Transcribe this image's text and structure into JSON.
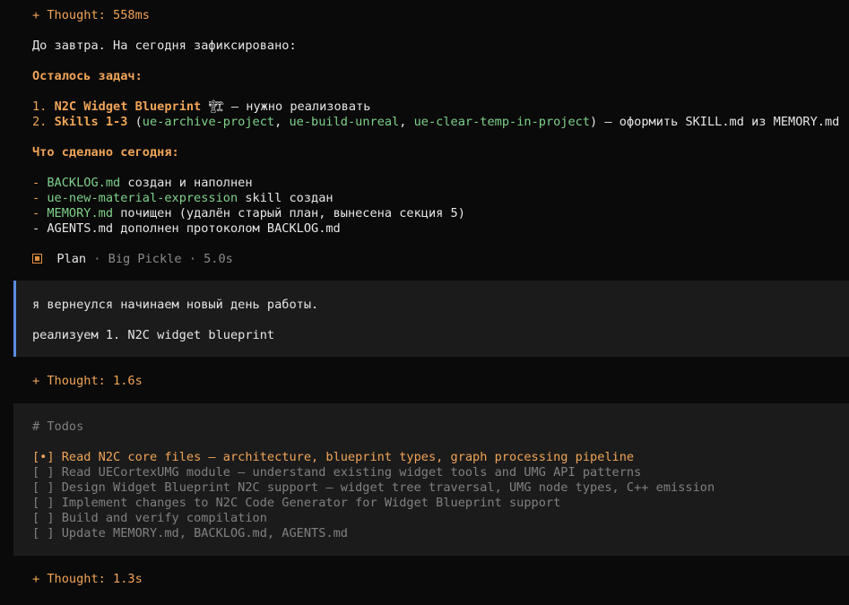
{
  "thought1": "+ Thought: 558ms",
  "intro": "До завтра. На сегодня зафиксировано:",
  "remaining_header": "Осталось задач:",
  "task1": {
    "num": "1. ",
    "title": "N2C Widget Blueprint",
    "icon": "🏗",
    "rest": " — нужно реализовать"
  },
  "task2": {
    "num": "2. ",
    "title": "Skills 1-3",
    "p_open": " (",
    "s1": "ue-archive-project",
    "c1": ", ",
    "s2": "ue-build-unreal",
    "c2": ", ",
    "s3": "ue-clear-temp-in-project",
    "rest": ") — оформить SKILL.md из MEMORY.md"
  },
  "done_header": "Что сделано сегодня:",
  "done": [
    {
      "dash": "- ",
      "link": "BACKLOG.md",
      "rest": " создан и наполнен"
    },
    {
      "dash": "- ",
      "link": "ue-new-material-expression",
      "rest": " skill создан"
    },
    {
      "dash": "- ",
      "link": "MEMORY.md",
      "rest": " почищен (удалён старый план, вынесена секция 5)"
    },
    {
      "dash": "- ",
      "link": "",
      "rest": "AGENTS.md дополнен протоколом BACKLOG.md"
    }
  ],
  "plan": {
    "mode": "Plan",
    "model": " · Big Pickle · 5.0s"
  },
  "user_msg": {
    "line1": "я вернеулся начинаем новый день работы.",
    "line2": "реализуем 1. N2C widget blueprint"
  },
  "thought2": "+ Thought: 1.6s",
  "todos": {
    "header": "# Todos",
    "items": [
      {
        "mark": "[•] ",
        "text": "Read N2C core files — architecture, blueprint types, graph processing pipeline"
      },
      {
        "mark": "[ ] ",
        "text": "Read UECortexUMG module — understand existing widget tools and UMG API patterns"
      },
      {
        "mark": "[ ] ",
        "text": "Design Widget Blueprint N2C support — widget tree traversal, UMG node types, C++ emission"
      },
      {
        "mark": "[ ] ",
        "text": "Implement changes to N2C Code Generator for Widget Blueprint support"
      },
      {
        "mark": "[ ] ",
        "text": "Build and verify compilation"
      },
      {
        "mark": "[ ] ",
        "text": "Update MEMORY.md, BACKLOG.md, AGENTS.md"
      }
    ]
  },
  "thought3": "+ Thought: 1.3s",
  "colors": {
    "accent_orange": "#f0a458",
    "link_green": "#7fd189",
    "user_border_blue": "#5b8de0",
    "background": "#0a0a0a",
    "panel": "#1b1b1b"
  }
}
